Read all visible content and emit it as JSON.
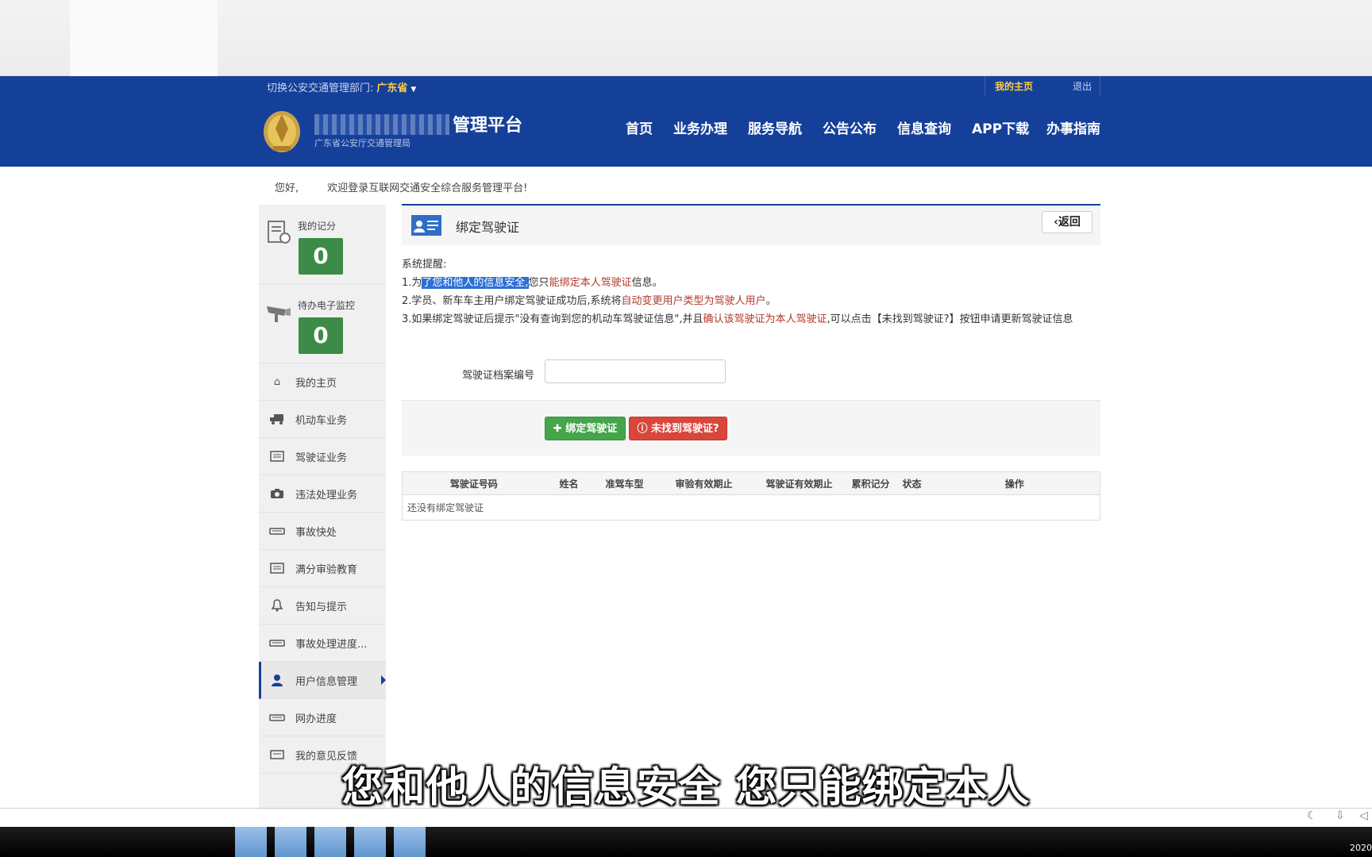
{
  "topbar": {
    "dept_label": "切换公安交通管理部门:",
    "dept_value": "广东省",
    "my_home": "我的主页",
    "logout": "退出"
  },
  "header": {
    "title": "管理平台",
    "subtitle": "广东省公安厅交通管理局",
    "nav": [
      "首页",
      "业务办理",
      "服务导航",
      "公告公布",
      "信息查询",
      "APP下载",
      "办事指南"
    ]
  },
  "greeting": {
    "hello": "您好,",
    "welcome": "欢迎登录互联网交通安全综合服务管理平台!"
  },
  "sidebar": {
    "stats": [
      {
        "label": "我的记分",
        "value": "0",
        "icon": "document-icon"
      },
      {
        "label": "待办电子监控",
        "value": "0",
        "icon": "camera-monitor-icon"
      }
    ],
    "items": [
      {
        "label": "我的主页",
        "icon": "home-icon"
      },
      {
        "label": "机动车业务",
        "icon": "truck-icon"
      },
      {
        "label": "驾驶证业务",
        "icon": "card-icon"
      },
      {
        "label": "违法处理业务",
        "icon": "camera-icon"
      },
      {
        "label": "事故快处",
        "icon": "car-icon"
      },
      {
        "label": "满分审验教育",
        "icon": "card-icon"
      },
      {
        "label": "告知与提示",
        "icon": "bell-icon"
      },
      {
        "label": "事故处理进度...",
        "icon": "car-icon"
      },
      {
        "label": "用户信息管理",
        "icon": "user-icon",
        "active": true
      },
      {
        "label": "网办进度",
        "icon": "car-icon"
      },
      {
        "label": "我的意见反馈",
        "icon": "feedback-icon"
      }
    ]
  },
  "panel": {
    "title": "绑定驾驶证",
    "back_label": "返回"
  },
  "notice": {
    "heading": "系统提醒:",
    "line1_prefix": "1.为",
    "line1_highlight": "了您和他人的信息安全,",
    "line1_mid": "您只",
    "line1_red": "能绑定本人驾驶证",
    "line1_suffix": "信息。",
    "line2_prefix": "2.学员、新车车主用户绑定驾驶证成功后,系统将",
    "line2_red": "自动变更用户类型为驾驶人用户",
    "line2_suffix": "。",
    "line3_prefix": "3.如果绑定驾驶证后提示\"没有查询到您的机动车驾驶证信息\",并且",
    "line3_red": "确认该驾驶证为本人驾驶证",
    "line3_suffix": ",可以点击【未找到驾驶证?】按钮申请更新驾驶证信息"
  },
  "form": {
    "label": "驾驶证档案编号",
    "value": "",
    "placeholder": ""
  },
  "actions": {
    "bind_label": "绑定驾驶证",
    "not_found_label": "未找到驾驶证?"
  },
  "table": {
    "headers": [
      "驾驶证号码",
      "姓名",
      "准驾车型",
      "审验有效期止",
      "驾驶证有效期止",
      "累积记分",
      "状态",
      "操作"
    ],
    "empty_text": "还没有绑定驾驶证"
  },
  "subtitle": "您和他人的信息安全 您只能绑定本人",
  "taskbar": {
    "clock": "2020"
  },
  "colors": {
    "brand_blue": "#15409a",
    "accent_yellow": "#ffcf42",
    "success_green": "#45a54a",
    "danger_red": "#d9463c",
    "stat_green": "#3c8b46"
  }
}
